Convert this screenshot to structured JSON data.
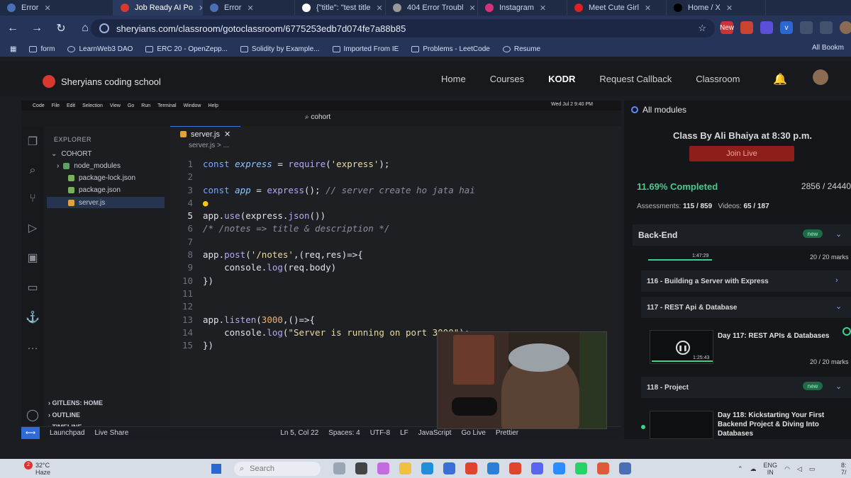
{
  "browser": {
    "tabs": [
      {
        "label": "Error"
      },
      {
        "label": "Job Ready AI Po"
      },
      {
        "label": "Error"
      },
      {
        "label": "{\"title\": \"test title"
      },
      {
        "label": "404 Error Troubl"
      },
      {
        "label": "Instagram"
      },
      {
        "label": "Meet Cute Girl"
      },
      {
        "label": "Home / X"
      }
    ],
    "url": "sheryians.com/classroom/gotoclassroom/6775253edb7d074fe7a88b85",
    "bookmarks": [
      "form",
      "LearnWeb3 DAO",
      "ERC 20 - OpenZepp...",
      "Solidity by Example...",
      "Imported From IE",
      "Problems - LeetCode",
      "Resume"
    ],
    "all_bookmarks": "All Bookm",
    "new_badge": "New"
  },
  "site": {
    "brand": "Sheryians coding school",
    "nav": [
      "Home",
      "Courses",
      "KODR",
      "Request Callback",
      "Classroom"
    ]
  },
  "vscode": {
    "menu": [
      "Code",
      "File",
      "Edit",
      "Selection",
      "View",
      "Go",
      "Run",
      "Terminal",
      "Window",
      "Help"
    ],
    "status_right": "Wed Jul 2  9:40 PM",
    "command_center": "cohort",
    "explorer_title": "EXPLORER",
    "folder": "COHORT",
    "files": [
      "node_modules",
      "package-lock.json",
      "package.json",
      "server.js"
    ],
    "panels": [
      "GITLENS: HOME",
      "OUTLINE",
      "TIMELINE"
    ],
    "tab": "server.js",
    "breadcrumb": "server.js > ...",
    "code_lines": [
      {
        "n": "1"
      },
      {
        "n": "2"
      },
      {
        "n": "3"
      },
      {
        "n": "4"
      },
      {
        "n": "5"
      },
      {
        "n": "6"
      },
      {
        "n": "7"
      },
      {
        "n": "8"
      },
      {
        "n": "9"
      },
      {
        "n": "10"
      },
      {
        "n": "11"
      },
      {
        "n": "12"
      },
      {
        "n": "13"
      },
      {
        "n": "14"
      },
      {
        "n": "15"
      }
    ],
    "code": {
      "l1_kw": "const ",
      "l1_var": "express",
      "l1_op": " = ",
      "l1_fn": "require",
      "l1_a": "(",
      "l1_str": "'express'",
      "l1_b": ");",
      "l3_kw": "const ",
      "l3_var": "app",
      "l3_op": " = ",
      "l3_fn": "express",
      "l3_a": "(); ",
      "l3_cm": "// server create ho jata hai",
      "l5_a": "app.",
      "l5_fn": "use",
      "l5_b": "(express.",
      "l5_fn2": "json",
      "l5_c": "())",
      "l6_cm": "/* /notes => title & description */",
      "l8_a": "app.",
      "l8_fn": "post",
      "l8_b": "(",
      "l8_str": "'/notes'",
      "l8_c": ",(req,res)=>{",
      "l9_a": "    console.",
      "l9_fn": "log",
      "l9_b": "(req.body)",
      "l10": "})",
      "l13_a": "app.",
      "l13_fn": "listen",
      "l13_b": "(",
      "l13_num": "3000",
      "l13_c": ",()=>{",
      "l14_a": "    console.",
      "l14_fn": "log",
      "l14_b": "(",
      "l14_str": "\"Server is running on port 3000\"",
      "l14_c": ");",
      "l15": "})"
    },
    "status": {
      "launchpad": "Launchpad",
      "liveshare": "Live Share",
      "position": "Ln 5, Col 22",
      "spaces": "Spaces: 4",
      "encoding": "UTF-8",
      "eol": "LF",
      "language": "JavaScript",
      "golive": "Go Live",
      "prettier": "Prettier"
    }
  },
  "course": {
    "all_modules": "All modules",
    "class_title": "Class By Ali Bhaiya at 8:30 p.m.",
    "join_live": "Join Live",
    "completed": "11.69% Completed",
    "count": "2856 / 24440",
    "assessments_label": "Assessments:",
    "assessments": "115 / 859",
    "videos_label": "Videos:",
    "videos": "65 / 187",
    "section": "Back-End",
    "new_label": "new",
    "mini_time": "1:47:29",
    "marks1": "20 / 20 marks",
    "module116": "116 - Building a Server with Express",
    "module117": "117 - REST Api & Database",
    "video117_title": "Day 117: REST APIs & Databases",
    "video117_time": "1:25:43",
    "marks2": "20 / 20 marks",
    "module118": "118 - Project",
    "new_label2": "new",
    "video118_title": "Day 118: Kickstarting Your First Backend Project & Diving Into Databases"
  },
  "taskbar": {
    "weather_temp": "32°C",
    "weather_desc": "Haze",
    "weather_badge": "2",
    "search": "Search",
    "lang1": "ENG",
    "lang2": "IN",
    "clock1": "8:",
    "clock2": "7/"
  }
}
